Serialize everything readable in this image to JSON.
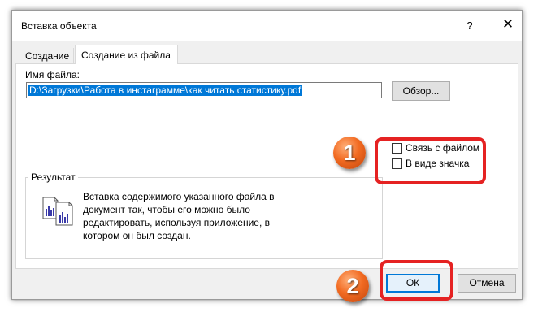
{
  "dialog": {
    "title": "Вставка объекта",
    "help_label": "?",
    "close_label": "✕"
  },
  "tabs": [
    {
      "label": "Создание",
      "active": false
    },
    {
      "label": "Создание из файла",
      "active": true
    }
  ],
  "file": {
    "label": "Имя файла:",
    "value": "D:\\Загрузки\\Работа в инстаграмме\\как читать статистику.pdf",
    "browse_label": "Обзор..."
  },
  "options": {
    "link_label": "Связь с файлом",
    "link_checked": false,
    "icon_label": "В виде значка",
    "icon_checked": false
  },
  "result": {
    "title": "Результат",
    "text": "Вставка содержимого указанного файла в документ так, чтобы его можно было редактировать, используя приложение, в котором он был создан."
  },
  "buttons": {
    "ok_label": "ОК",
    "cancel_label": "Отмена"
  },
  "annotations": {
    "badge_1": "1",
    "badge_2": "2",
    "color": "#e52222",
    "badge_color": "#f26b22"
  },
  "colors": {
    "accent": "#0078d7",
    "selection": "#0078d7"
  }
}
